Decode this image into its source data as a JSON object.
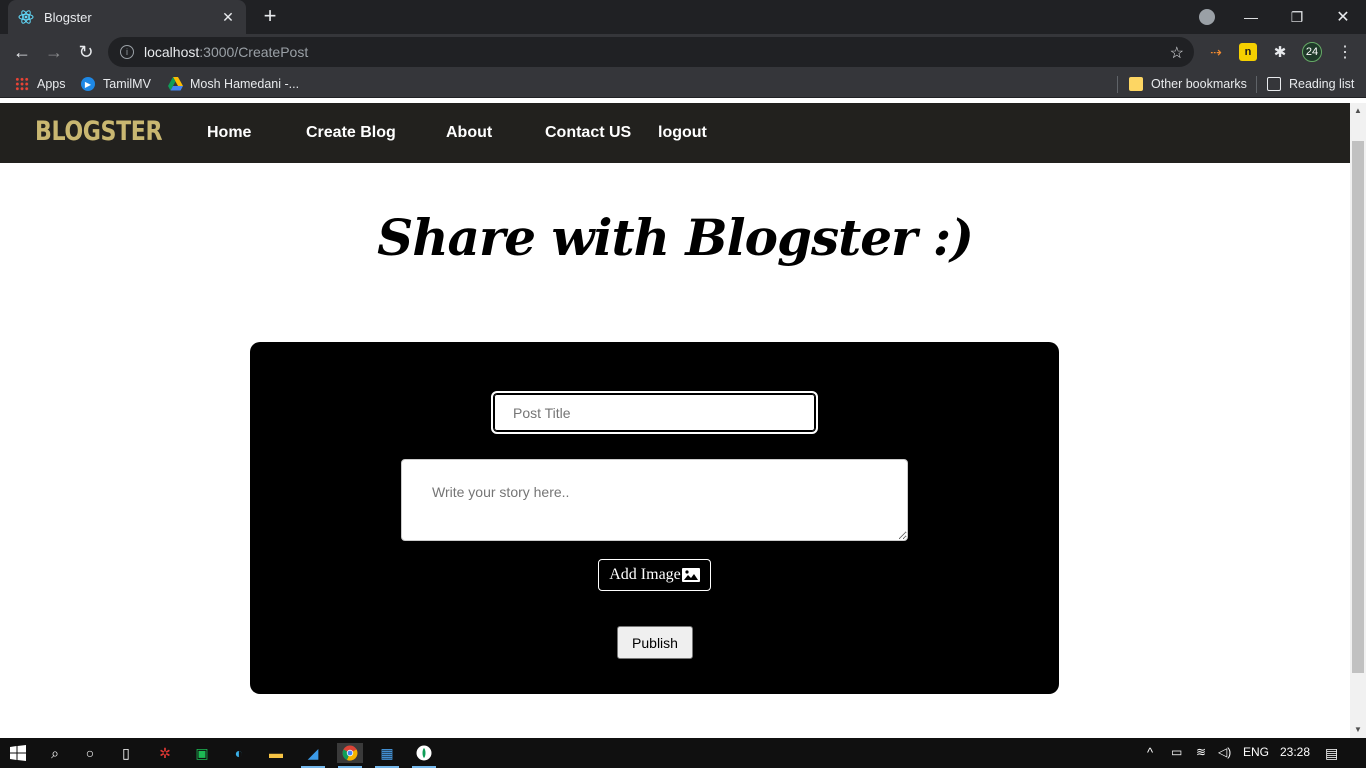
{
  "browser": {
    "tab_title": "Blogster",
    "url_host": "localhost",
    "url_path": ":3000/CreatePost",
    "bookmarks": {
      "apps": "Apps",
      "tamilmv": "TamilMV",
      "mosh": "Mosh Hamedani -...",
      "other": "Other bookmarks",
      "reading": "Reading list"
    },
    "profile_initials": "24"
  },
  "site": {
    "brand": "BLOGSTER",
    "nav": {
      "home": "Home",
      "create": "Create Blog",
      "about": "About",
      "contact": "Contact US",
      "logout": "logout"
    },
    "heading": "Share with Blogster :)",
    "form": {
      "title_placeholder": "Post Title",
      "title_value": "",
      "story_placeholder": "Write your story here..",
      "story_value": "",
      "add_image_label": "Add Image",
      "publish_label": "Publish"
    }
  },
  "taskbar": {
    "language": "ENG",
    "time": "23:28"
  },
  "colors": {
    "brand_gold": "#c9b771",
    "nav_bg": "#22211e",
    "panel_bg": "#000000"
  }
}
